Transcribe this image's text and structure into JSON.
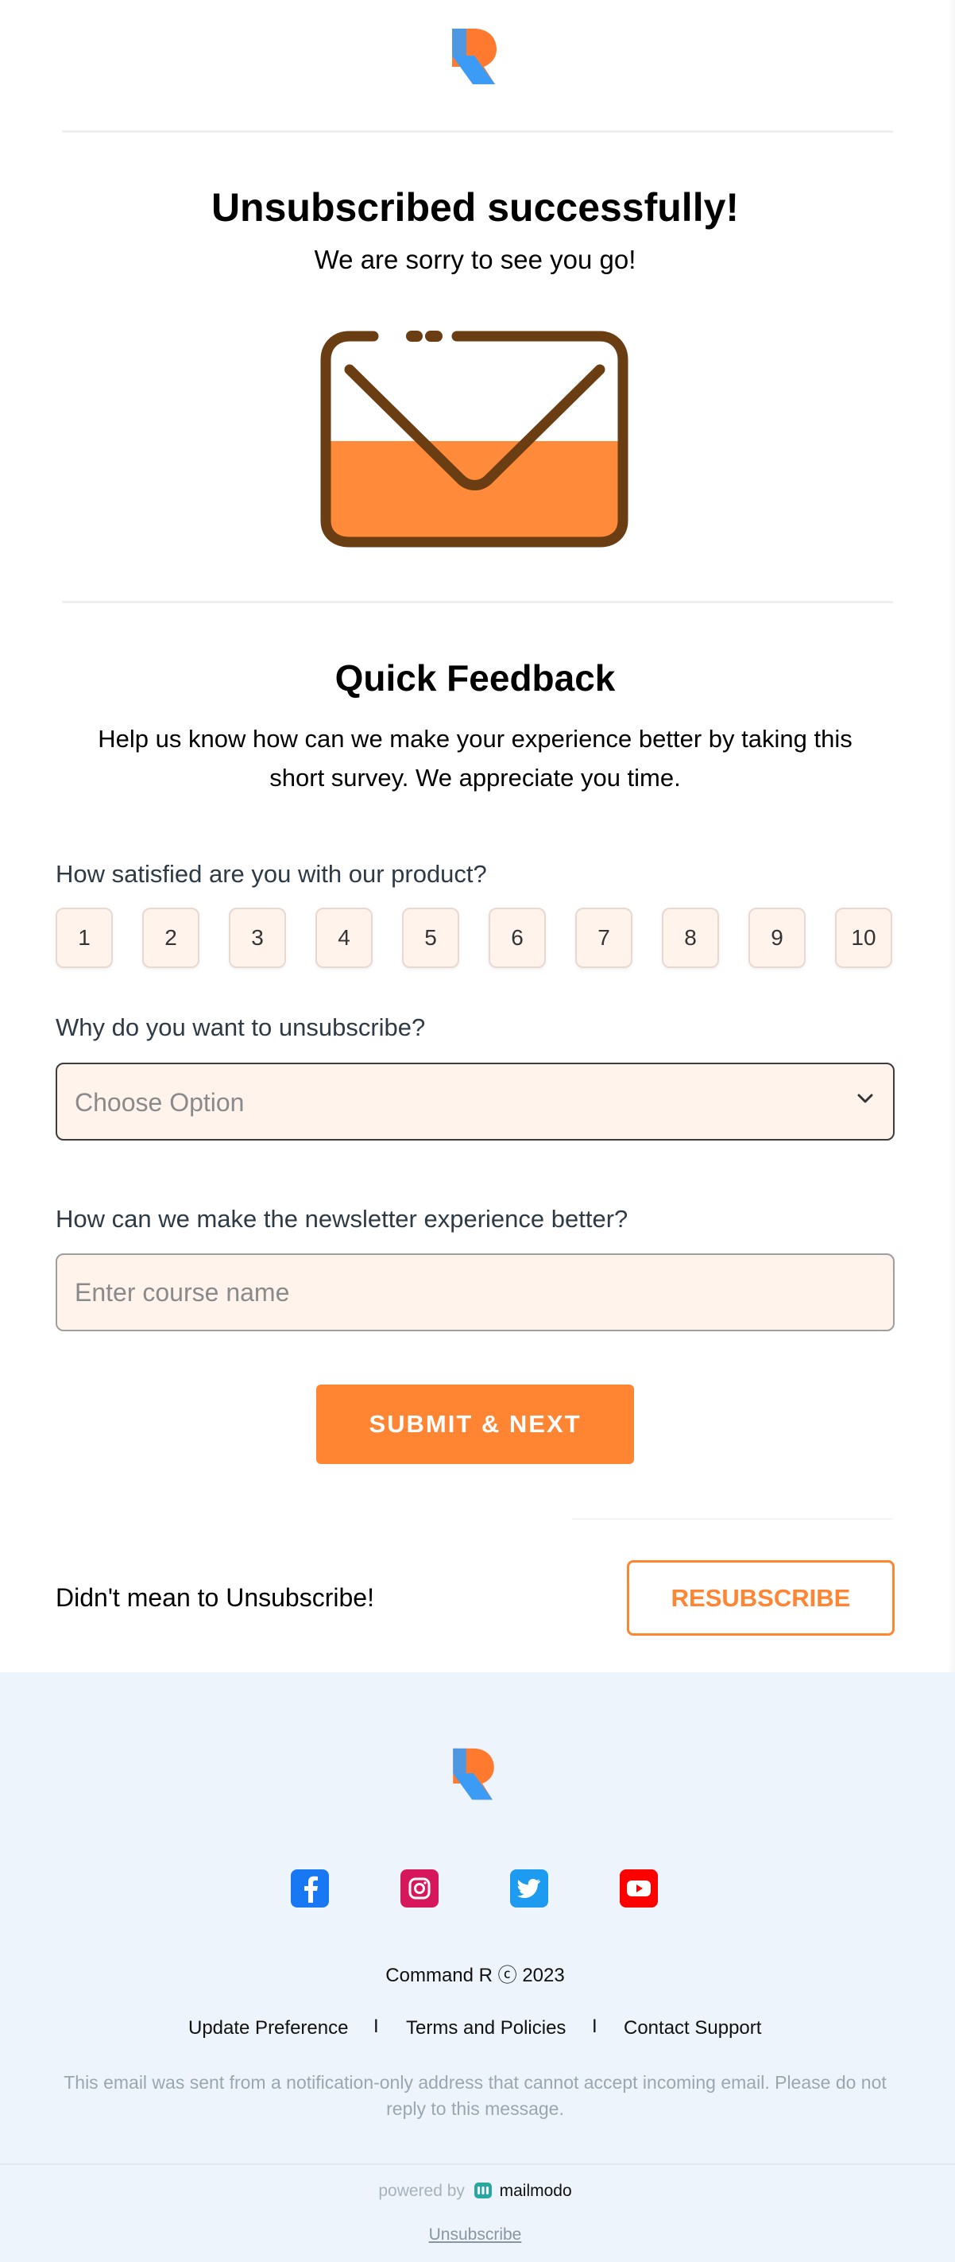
{
  "header": {
    "logo_name": "R-logo"
  },
  "hero": {
    "title": "Unsubscribed successfully!",
    "subtitle": "We are sorry to see you go!",
    "illustration": "envelope-icon"
  },
  "feedback": {
    "title": "Quick Feedback",
    "description_line1": "Help us know how can we make your experience better by taking this",
    "description_line2": "short survey. We appreciate you time.",
    "q1": {
      "label": "How satisfied are you with our product?",
      "options": [
        "1",
        "2",
        "3",
        "4",
        "5",
        "6",
        "7",
        "8",
        "9",
        "10"
      ]
    },
    "q2": {
      "label": "Why do you want to unsubscribe?",
      "selected": "Choose Option"
    },
    "q3": {
      "label": "How can we make the newsletter experience better?",
      "placeholder": "Enter course name"
    },
    "submit_label": "SUBMIT & NEXT"
  },
  "resubscribe": {
    "text": "Didn't mean to Unsubscribe!",
    "button_label": "RESUBSCRIBE"
  },
  "footer": {
    "social": [
      {
        "name": "facebook-icon",
        "color": "#1877f2"
      },
      {
        "name": "instagram-icon",
        "color": "#d6175c"
      },
      {
        "name": "twitter-icon",
        "color": "#1d9bf0"
      },
      {
        "name": "youtube-icon",
        "color": "#ff0000"
      }
    ],
    "copyright": "Command R ⓒ 2023",
    "links": [
      "Update Preference",
      "Terms and Policies",
      "Contact Support"
    ],
    "separator": "I",
    "note": "This email was sent from a notification-only address that cannot accept incoming email. Please do not reply to this message.",
    "powered_by": "powered by",
    "brand": "mailmodo",
    "unsubscribe": "Unsubscribe"
  },
  "colors": {
    "accent": "#ff8533",
    "logo_orange": "#ff7a2f",
    "logo_blue": "#3b9bf5",
    "footer_bg": "#eef4fb"
  }
}
